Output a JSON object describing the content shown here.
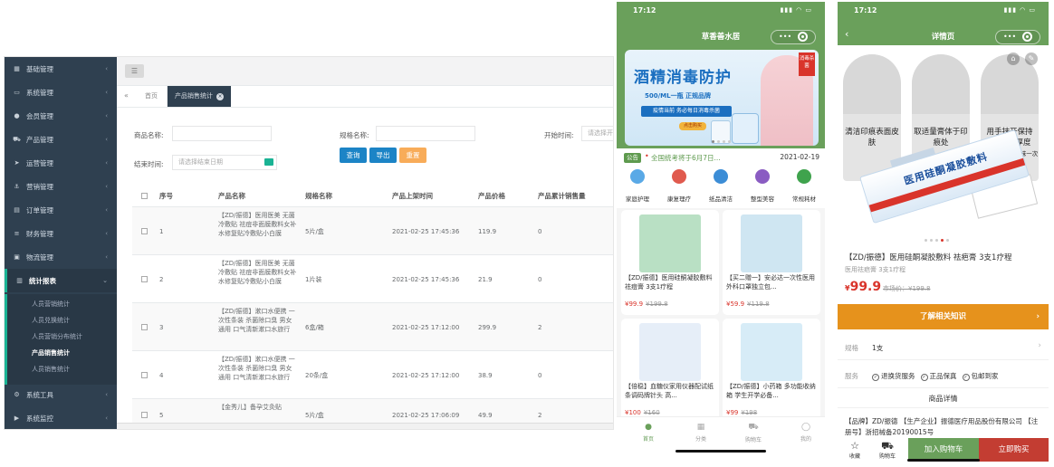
{
  "admin": {
    "sidebar": [
      {
        "label": "基础管理",
        "icon": "grid-icon"
      },
      {
        "label": "系统管理",
        "icon": "monitor-icon"
      },
      {
        "label": "会员管理",
        "icon": "user-icon"
      },
      {
        "label": "产品管理",
        "icon": "cart-icon"
      },
      {
        "label": "运营管理",
        "icon": "send-icon"
      },
      {
        "label": "营销管理",
        "icon": "anchor-icon"
      },
      {
        "label": "订单管理",
        "icon": "card-icon"
      },
      {
        "label": "财务管理",
        "icon": "list-icon"
      },
      {
        "label": "物流管理",
        "icon": "box-icon"
      },
      {
        "label": "统计报表",
        "icon": "chart-icon"
      }
    ],
    "sidebar_sub": [
      "人员营销统计",
      "人员兑换统计",
      "人员营销分布统计",
      "产品销售统计",
      "人员销售统计"
    ],
    "sidebar_bottom": [
      {
        "label": "系统工具",
        "icon": "gear-icon"
      },
      {
        "label": "系统监控",
        "icon": "video-icon"
      }
    ],
    "tabs": {
      "home": "首页",
      "current": "产品销售统计"
    },
    "filters": {
      "product_name_label": "商品名称:",
      "spec_label": "规格名称:",
      "start_label": "开始时间:",
      "start_placeholder": "请选择开",
      "end_label": "结束时间:",
      "end_placeholder": "请选择结束日期",
      "query": "查询",
      "export": "导出",
      "reset": "重置"
    },
    "columns": [
      "序号",
      "产品名称",
      "规格名称",
      "产品上架时间",
      "产品价格",
      "产品累计销售量"
    ],
    "rows": [
      {
        "no": "1",
        "name": "【ZD/振德】医用医美 无菌冷敷贴 祛痘非面膜敷料女补水修复贴冷敷贴小白膜",
        "spec": "5片/盒",
        "time": "2021-02-25 17:45:36",
        "price": "119.9",
        "sales": "0"
      },
      {
        "no": "2",
        "name": "【ZD/振德】医用医美 无菌冷敷贴 祛痘非面膜敷料女补水修复贴冷敷贴小白膜",
        "spec": "1片装",
        "time": "2021-02-25 17:45:36",
        "price": "21.9",
        "sales": "0"
      },
      {
        "no": "3",
        "name": "【ZD/振德】漱口水便携 一次性条装 杀菌除口臭 男女通用 口气清新漱口水旅行",
        "spec": "6盒/箱",
        "time": "2021-02-25 17:12:00",
        "price": "299.9",
        "sales": "2"
      },
      {
        "no": "4",
        "name": "【ZD/振德】漱口水便携 一次性条装 杀菌除口臭 男女通用 口气清新漱口水旅行",
        "spec": "20条/盒",
        "time": "2021-02-25 17:12:00",
        "price": "38.9",
        "sales": "0"
      },
      {
        "no": "5",
        "name": "【金秀儿】备孕艾灸贴",
        "spec": "5片/盒",
        "time": "2021-02-25 17:06:09",
        "price": "49.9",
        "sales": "2"
      }
    ]
  },
  "phone1": {
    "time": "17:12",
    "title": "草香善水居",
    "banner": {
      "title": "酒精消毒防护",
      "sub": "500/ML一瓶 正规品牌",
      "tag": "疫情当前 务必每日消毒杀菌",
      "corner": "消毒杀菌",
      "btn": "点击购买"
    },
    "notice": {
      "tag": "公告",
      "text": "全国统考将于6月7日...",
      "date": "2021-02-19"
    },
    "categories": [
      {
        "label": "家庭护理",
        "color": "#5aa9e6"
      },
      {
        "label": "康复理疗",
        "color": "#e05a4e"
      },
      {
        "label": "纸品清洁",
        "color": "#3c8dd6"
      },
      {
        "label": "整型美容",
        "color": "#8a5cc2"
      },
      {
        "label": "常规耗材",
        "color": "#3fa34d"
      }
    ],
    "products": [
      {
        "name": "【ZD/振德】医用硅酮凝胶敷料 祛痘膏 3支1疗程",
        "price": "¥99.9",
        "orig": "¥199.8",
        "color": "#b9e0c4"
      },
      {
        "name": "【买二赠一】安必达一次性医用外科口罩独立包...",
        "price": "¥59.9",
        "orig": "¥119.8",
        "color": "#cfe6f2"
      },
      {
        "name": "【倍稳】血糖仪家用仪器配试纸条调码牌针头 高...",
        "price": "¥100",
        "orig": "¥160",
        "color": "#e6eef8"
      },
      {
        "name": "【ZD/振德】小药箱 多功能收纳箱 学生开学必备...",
        "price": "¥99",
        "orig": "¥198",
        "color": "#d7ecf7"
      }
    ],
    "tabbar": [
      "首页",
      "分类",
      "购物车",
      "我的"
    ]
  },
  "phone2": {
    "time": "17:12",
    "title": "详情页",
    "steps": [
      {
        "main": "清洁印痕表面皮肤",
        "small": ""
      },
      {
        "main": "取适量膏体于印痕处",
        "small": ""
      },
      {
        "main": "用手抹开保持0.1mm厚度",
        "small": "每隔3-4小时涂抹一次"
      }
    ],
    "tube_label": "医用硅酮凝胶敷料",
    "name": "【ZD/振德】医用硅酮凝胶敷料 祛疤膏 3支1疗程",
    "sub": "医用祛疤膏 3支1疗程",
    "price": "99.9",
    "currency": "¥",
    "market": "市场价：¥199.8",
    "knowledge": "了解相关知识",
    "spec_label": "规格",
    "spec_value": "1支",
    "service_label": "服务",
    "services": [
      "退换货服务",
      "正品保真",
      "包邮到家"
    ],
    "detail_heading": "商品详情",
    "info": "【品牌】ZD/振德 【生产企业】振德医疗用品股份有限公司 【注册号】浙招械备20190015号",
    "collect": "收藏",
    "cart": "购物车",
    "add_cart": "加入购物车",
    "buy_now": "立即购买"
  }
}
